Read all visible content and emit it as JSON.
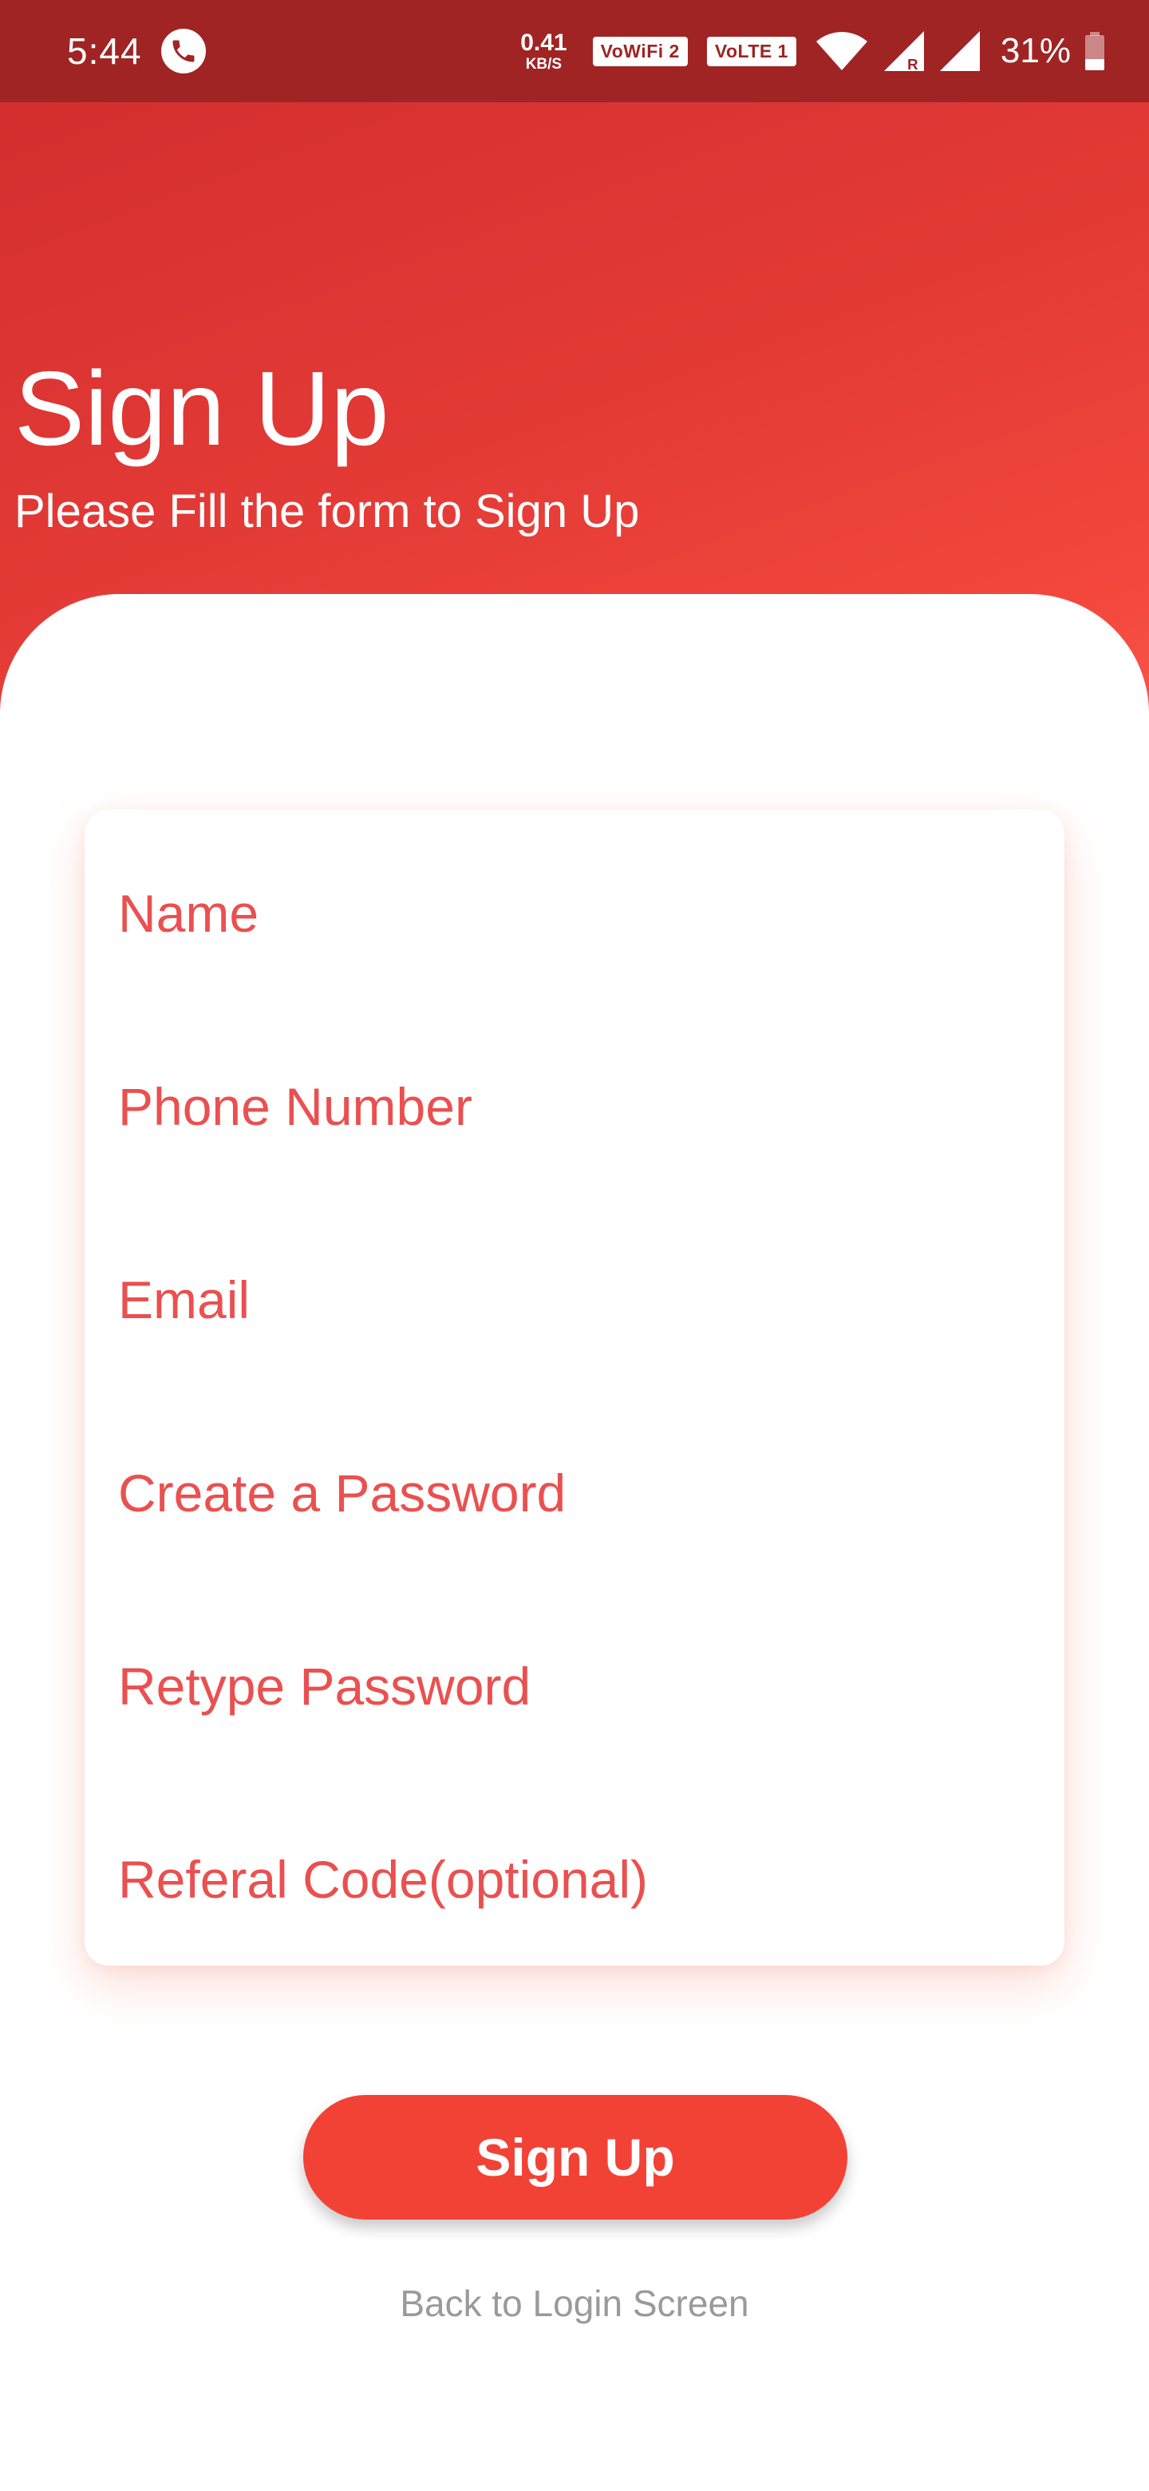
{
  "status_bar": {
    "time": "5:44",
    "net_speed_value": "0.41",
    "net_speed_unit": "KB/S",
    "wifi_badge": "VoWiFi 2",
    "lte_badge": "VoLTE 1",
    "battery_percent": "31%",
    "battery_level": 0.31,
    "icons": [
      "phone-call-icon",
      "wifi-icon",
      "signal-roaming-icon",
      "signal-icon",
      "battery-icon"
    ]
  },
  "header": {
    "title": "Sign Up",
    "subtitle": "Please Fill the form to Sign Up"
  },
  "form": {
    "fields": [
      {
        "placeholder": "Name",
        "value": ""
      },
      {
        "placeholder": "Phone Number",
        "value": ""
      },
      {
        "placeholder": "Email",
        "value": ""
      },
      {
        "placeholder": "Create a Password",
        "value": ""
      },
      {
        "placeholder": "Retype Password",
        "value": ""
      },
      {
        "placeholder": "Referal Code(optional)",
        "value": ""
      }
    ]
  },
  "actions": {
    "signup_label": "Sign Up",
    "back_label": "Back to Login Screen"
  },
  "colors": {
    "status_bar": "#a02424",
    "accent": "#f24236",
    "placeholder": "#ea5050",
    "link": "#9a9a9a"
  }
}
